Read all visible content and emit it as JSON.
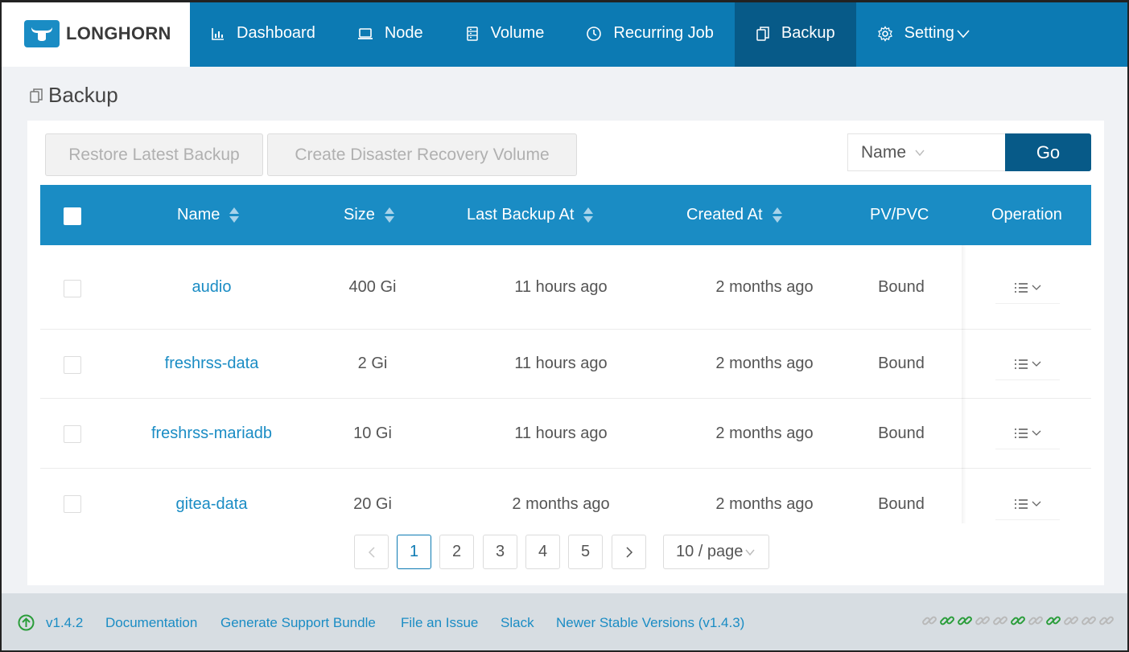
{
  "app": {
    "logo_text": "LONGHORN"
  },
  "nav": [
    {
      "label": "Dashboard",
      "icon": "bar-chart-icon",
      "active": false
    },
    {
      "label": "Node",
      "icon": "laptop-icon",
      "active": false
    },
    {
      "label": "Volume",
      "icon": "database-icon",
      "active": false
    },
    {
      "label": "Recurring Job",
      "icon": "clock-icon",
      "active": false
    },
    {
      "label": "Backup",
      "icon": "copy-icon",
      "active": true
    },
    {
      "label": "Setting",
      "icon": "gear-icon",
      "active": false
    }
  ],
  "page": {
    "title": "Backup"
  },
  "toolbar": {
    "restore_label": "Restore Latest Backup",
    "create_dr_label": "Create Disaster Recovery Volume",
    "search_field": "Name",
    "search_value": "",
    "go_label": "Go"
  },
  "table": {
    "columns": {
      "name": "Name",
      "size": "Size",
      "last_backup": "Last Backup At",
      "created": "Created At",
      "pvpvc": "PV/PVC",
      "operation": "Operation"
    },
    "rows": [
      {
        "name": "audio",
        "size": "400 Gi",
        "last_backup": "11 hours ago",
        "created": "2 months ago",
        "pvpvc": "Bound"
      },
      {
        "name": "freshrss-data",
        "size": "2 Gi",
        "last_backup": "11 hours ago",
        "created": "2 months ago",
        "pvpvc": "Bound"
      },
      {
        "name": "freshrss-mariadb",
        "size": "10 Gi",
        "last_backup": "11 hours ago",
        "created": "2 months ago",
        "pvpvc": "Bound"
      },
      {
        "name": "gitea-data",
        "size": "20 Gi",
        "last_backup": "2 months ago",
        "created": "2 months ago",
        "pvpvc": "Bound"
      }
    ]
  },
  "pagination": {
    "pages": [
      "1",
      "2",
      "3",
      "4",
      "5"
    ],
    "current": "1",
    "page_size": "10 / page"
  },
  "footer": {
    "version": "v1.4.2",
    "documentation": "Documentation",
    "support_bundle": "Generate Support Bundle",
    "file_issue": "File an Issue",
    "slack": "Slack",
    "newer_versions": "Newer Stable Versions (v1.4.3)",
    "link_status": [
      "grey",
      "green",
      "green",
      "grey",
      "grey",
      "green",
      "grey",
      "green",
      "grey",
      "grey",
      "grey"
    ]
  },
  "colors": {
    "brand": "#0c7ab3",
    "nav_active": "#075a88",
    "table_header": "#1a8cc4",
    "link": "#1a8cc4",
    "status_green": "#2a9d3a",
    "status_grey": "#b9b9b9"
  }
}
